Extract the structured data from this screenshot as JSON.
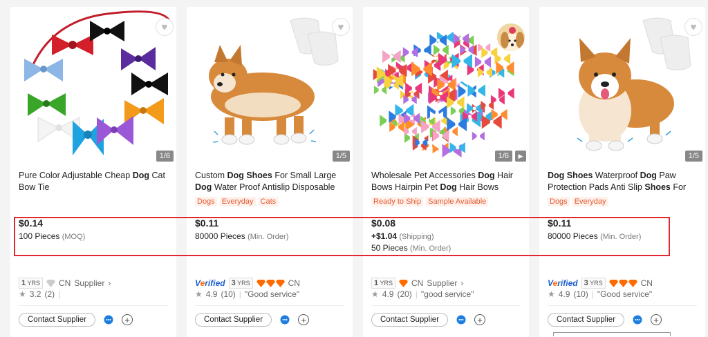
{
  "products": [
    {
      "title_segments": [
        {
          "text": "Pure Color Adjustable Cheap ",
          "bold": false
        },
        {
          "text": "Dog",
          "bold": true
        },
        {
          "text": " Cat Bow Tie",
          "bold": false
        }
      ],
      "image_counter": "1/6",
      "tags": [],
      "price": "$0.14",
      "shipping": null,
      "moq_value": "100 Pieces",
      "moq_note": "(MOQ)",
      "years": "1",
      "years_unit": "YRS",
      "verified": false,
      "country": "CN",
      "supplier_label": "Supplier",
      "rating": "3.2",
      "reviews": "(2)",
      "review_quote": "",
      "contact_label": "Contact Supplier"
    },
    {
      "title_segments": [
        {
          "text": "Custom ",
          "bold": false
        },
        {
          "text": "Dog Shoes",
          "bold": true
        },
        {
          "text": " For Small Large ",
          "bold": false
        },
        {
          "text": "Dog",
          "bold": true
        },
        {
          "text": " Water Proof Antislip Disposable",
          "bold": false
        }
      ],
      "image_counter": "1/5",
      "tags": [
        "Dogs",
        "Everyday",
        "Cats"
      ],
      "price": "$0.11",
      "shipping": null,
      "moq_value": "80000 Pieces",
      "moq_note": "(Min. Order)",
      "years": "3",
      "years_unit": "YRS",
      "verified": true,
      "verified_label": "Verified",
      "country": "CN",
      "supplier_label": "",
      "rating": "4.9",
      "reviews": "(10)",
      "review_quote": "\"Good service\"",
      "contact_label": "Contact Supplier"
    },
    {
      "title_segments": [
        {
          "text": "Wholesale Pet Accessories ",
          "bold": false
        },
        {
          "text": "Dog",
          "bold": true
        },
        {
          "text": " Hair Bows Hairpin Pet ",
          "bold": false
        },
        {
          "text": "Dog",
          "bold": true
        },
        {
          "text": " Hair Bows",
          "bold": false
        }
      ],
      "image_counter": "1/6",
      "tags": [
        "Ready to Ship",
        "Sample Available"
      ],
      "price": "$0.08",
      "shipping": {
        "value": "+$1.04",
        "note": "(Shipping)"
      },
      "moq_value": "50 Pieces",
      "moq_note": "(Min. Order)",
      "years": "1",
      "years_unit": "YRS",
      "verified": false,
      "country": "CN",
      "supplier_label": "Supplier",
      "rating": "4.9",
      "reviews": "(20)",
      "review_quote": "\"good service\"",
      "contact_label": "Contact Supplier"
    },
    {
      "title_segments": [
        {
          "text": "Dog Shoes",
          "bold": true
        },
        {
          "text": " Waterproof ",
          "bold": false
        },
        {
          "text": "Dog",
          "bold": true
        },
        {
          "text": " Paw Protection Pads Anti Slip ",
          "bold": false
        },
        {
          "text": "Shoes",
          "bold": true
        },
        {
          "text": " For",
          "bold": false
        }
      ],
      "image_counter": "1/5",
      "tags": [
        "Dogs",
        "Everyday"
      ],
      "price": "$0.11",
      "shipping": null,
      "moq_value": "80000 Pieces",
      "moq_note": "(Min. Order)",
      "years": "3",
      "years_unit": "YRS",
      "verified": true,
      "verified_label": "Verified",
      "country": "CN",
      "supplier_label": "",
      "rating": "4.9",
      "reviews": "(10)",
      "review_quote": "\"Good service\"",
      "contact_label": "Contact Supplier"
    }
  ],
  "colors": {
    "tag_text": "#e4572e",
    "highlight": "#e0282e",
    "verified_blue": "#1a5fd0",
    "diamond_orange": "#ff6a00"
  }
}
